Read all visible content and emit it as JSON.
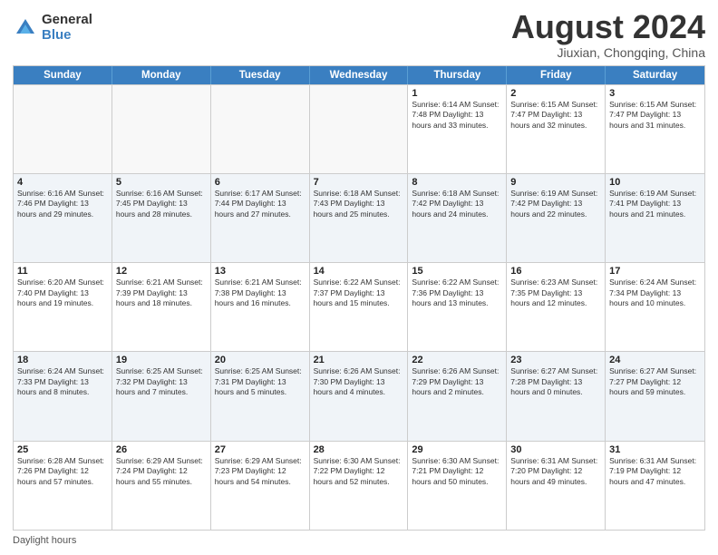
{
  "header": {
    "logo_general": "General",
    "logo_blue": "Blue",
    "title": "August 2024",
    "location": "Jiuxian, Chongqing, China"
  },
  "days_of_week": [
    "Sunday",
    "Monday",
    "Tuesday",
    "Wednesday",
    "Thursday",
    "Friday",
    "Saturday"
  ],
  "weeks": [
    [
      {
        "day": "",
        "info": ""
      },
      {
        "day": "",
        "info": ""
      },
      {
        "day": "",
        "info": ""
      },
      {
        "day": "",
        "info": ""
      },
      {
        "day": "1",
        "info": "Sunrise: 6:14 AM\nSunset: 7:48 PM\nDaylight: 13 hours\nand 33 minutes."
      },
      {
        "day": "2",
        "info": "Sunrise: 6:15 AM\nSunset: 7:47 PM\nDaylight: 13 hours\nand 32 minutes."
      },
      {
        "day": "3",
        "info": "Sunrise: 6:15 AM\nSunset: 7:47 PM\nDaylight: 13 hours\nand 31 minutes."
      }
    ],
    [
      {
        "day": "4",
        "info": "Sunrise: 6:16 AM\nSunset: 7:46 PM\nDaylight: 13 hours\nand 29 minutes."
      },
      {
        "day": "5",
        "info": "Sunrise: 6:16 AM\nSunset: 7:45 PM\nDaylight: 13 hours\nand 28 minutes."
      },
      {
        "day": "6",
        "info": "Sunrise: 6:17 AM\nSunset: 7:44 PM\nDaylight: 13 hours\nand 27 minutes."
      },
      {
        "day": "7",
        "info": "Sunrise: 6:18 AM\nSunset: 7:43 PM\nDaylight: 13 hours\nand 25 minutes."
      },
      {
        "day": "8",
        "info": "Sunrise: 6:18 AM\nSunset: 7:42 PM\nDaylight: 13 hours\nand 24 minutes."
      },
      {
        "day": "9",
        "info": "Sunrise: 6:19 AM\nSunset: 7:42 PM\nDaylight: 13 hours\nand 22 minutes."
      },
      {
        "day": "10",
        "info": "Sunrise: 6:19 AM\nSunset: 7:41 PM\nDaylight: 13 hours\nand 21 minutes."
      }
    ],
    [
      {
        "day": "11",
        "info": "Sunrise: 6:20 AM\nSunset: 7:40 PM\nDaylight: 13 hours\nand 19 minutes."
      },
      {
        "day": "12",
        "info": "Sunrise: 6:21 AM\nSunset: 7:39 PM\nDaylight: 13 hours\nand 18 minutes."
      },
      {
        "day": "13",
        "info": "Sunrise: 6:21 AM\nSunset: 7:38 PM\nDaylight: 13 hours\nand 16 minutes."
      },
      {
        "day": "14",
        "info": "Sunrise: 6:22 AM\nSunset: 7:37 PM\nDaylight: 13 hours\nand 15 minutes."
      },
      {
        "day": "15",
        "info": "Sunrise: 6:22 AM\nSunset: 7:36 PM\nDaylight: 13 hours\nand 13 minutes."
      },
      {
        "day": "16",
        "info": "Sunrise: 6:23 AM\nSunset: 7:35 PM\nDaylight: 13 hours\nand 12 minutes."
      },
      {
        "day": "17",
        "info": "Sunrise: 6:24 AM\nSunset: 7:34 PM\nDaylight: 13 hours\nand 10 minutes."
      }
    ],
    [
      {
        "day": "18",
        "info": "Sunrise: 6:24 AM\nSunset: 7:33 PM\nDaylight: 13 hours\nand 8 minutes."
      },
      {
        "day": "19",
        "info": "Sunrise: 6:25 AM\nSunset: 7:32 PM\nDaylight: 13 hours\nand 7 minutes."
      },
      {
        "day": "20",
        "info": "Sunrise: 6:25 AM\nSunset: 7:31 PM\nDaylight: 13 hours\nand 5 minutes."
      },
      {
        "day": "21",
        "info": "Sunrise: 6:26 AM\nSunset: 7:30 PM\nDaylight: 13 hours\nand 4 minutes."
      },
      {
        "day": "22",
        "info": "Sunrise: 6:26 AM\nSunset: 7:29 PM\nDaylight: 13 hours\nand 2 minutes."
      },
      {
        "day": "23",
        "info": "Sunrise: 6:27 AM\nSunset: 7:28 PM\nDaylight: 13 hours\nand 0 minutes."
      },
      {
        "day": "24",
        "info": "Sunrise: 6:27 AM\nSunset: 7:27 PM\nDaylight: 12 hours\nand 59 minutes."
      }
    ],
    [
      {
        "day": "25",
        "info": "Sunrise: 6:28 AM\nSunset: 7:26 PM\nDaylight: 12 hours\nand 57 minutes."
      },
      {
        "day": "26",
        "info": "Sunrise: 6:29 AM\nSunset: 7:24 PM\nDaylight: 12 hours\nand 55 minutes."
      },
      {
        "day": "27",
        "info": "Sunrise: 6:29 AM\nSunset: 7:23 PM\nDaylight: 12 hours\nand 54 minutes."
      },
      {
        "day": "28",
        "info": "Sunrise: 6:30 AM\nSunset: 7:22 PM\nDaylight: 12 hours\nand 52 minutes."
      },
      {
        "day": "29",
        "info": "Sunrise: 6:30 AM\nSunset: 7:21 PM\nDaylight: 12 hours\nand 50 minutes."
      },
      {
        "day": "30",
        "info": "Sunrise: 6:31 AM\nSunset: 7:20 PM\nDaylight: 12 hours\nand 49 minutes."
      },
      {
        "day": "31",
        "info": "Sunrise: 6:31 AM\nSunset: 7:19 PM\nDaylight: 12 hours\nand 47 minutes."
      }
    ]
  ],
  "footer": {
    "label": "Daylight hours"
  }
}
